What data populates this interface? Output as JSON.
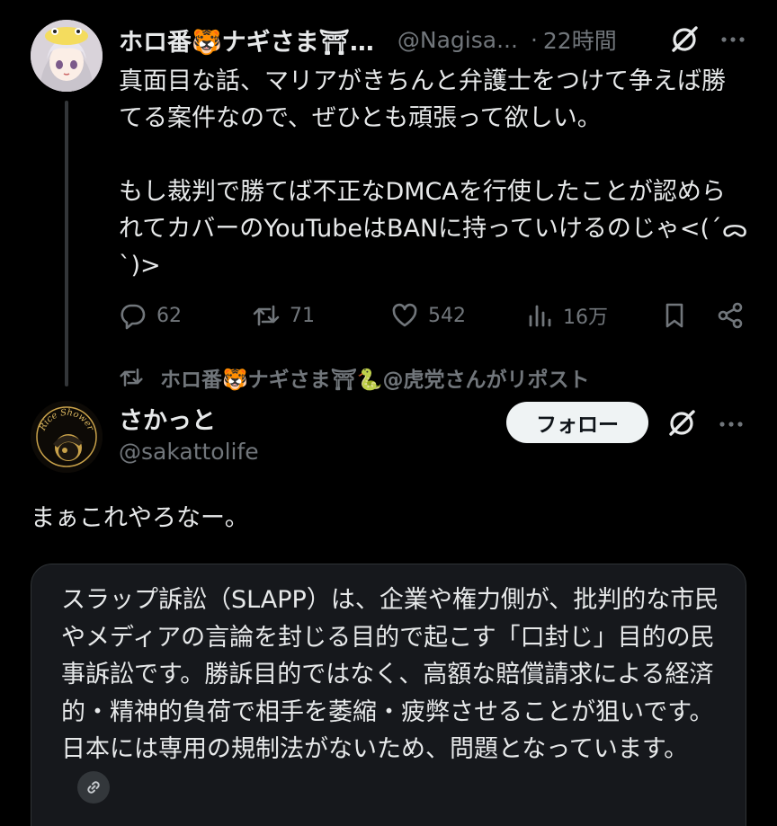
{
  "tweet1": {
    "author_name": "ホロ番🐯ナギさま⛩…",
    "handle": "@Nagisa...",
    "time": "22時間",
    "body": "真面目な話、マリアがきちんと弁護士をつけて争えば勝てる案件なので、ぜひとも頑張って欲しい。\n\nもし裁判で勝てば不正なDMCAを行使したことが認められてカバーのYouTubeはBANに持っていけるのじゃ<(´ᯅ`)>",
    "replies": "62",
    "reposts": "71",
    "likes": "542",
    "views": "16万"
  },
  "repost_line": "ホロ番🐯ナギさま⛩🐍@虎党さんがリポスト",
  "tweet2": {
    "author_name": "さかっと",
    "handle": "@sakattolife",
    "follow_label": "フォロー",
    "body": "まぁこれやろなー。",
    "avatar_text": "Rice Shower"
  },
  "card": {
    "text": "スラップ訴訟（SLAPP）は、企業や権力側が、批判的な市民やメディアの言論を封じる目的で起こす「口封じ」目的の民事訴訟です。勝訴目的ではなく、高額な賠償請求による経済的・精神的負荷で相手を萎縮・疲弊させることが狙いです。日本には専用の規制法がないため、問題となっています。"
  },
  "icons": {
    "grok": "grok-icon",
    "more": "more-icon",
    "reply": "reply-icon",
    "repost": "repost-icon",
    "like": "like-icon",
    "views": "views-icon",
    "bookmark": "bookmark-icon",
    "share": "share-icon",
    "link": "link-icon"
  },
  "colors": {
    "background": "#000000",
    "text": "#e7e9ea",
    "secondary": "#71767b",
    "card_bg": "#16181c",
    "follow_bg": "#eff3f4"
  }
}
